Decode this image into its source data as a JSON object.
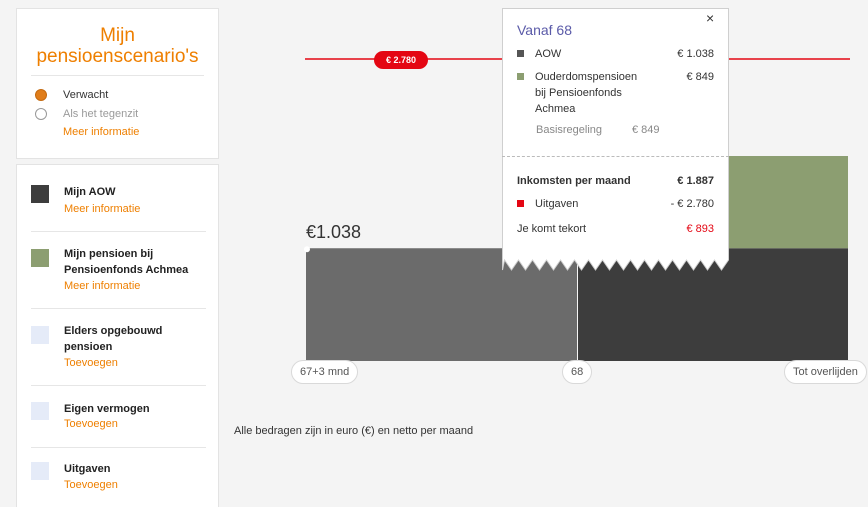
{
  "scenarios": {
    "title_line1": "Mijn",
    "title_line2": "pensioenscenario's",
    "options": [
      {
        "label": "Verwacht",
        "checked": true
      },
      {
        "label": "Als het tegenzit",
        "checked": false
      }
    ],
    "more_info": "Meer informatie"
  },
  "legend": {
    "items": [
      {
        "line1": "Mijn AOW",
        "line2": "",
        "link": "Meer informatie",
        "color": "#3d3d3d"
      },
      {
        "line1": "Mijn pensioen bij",
        "line2": "Pensioenfonds Achmea",
        "link": "Meer informatie",
        "color": "#8c9e71"
      },
      {
        "line1": "Elders opgebouwd",
        "line2": "pensioen",
        "link": "Toevoegen",
        "color": "#e5ebf8"
      },
      {
        "line1": "Eigen vermogen",
        "line2": "",
        "link": "Toevoegen",
        "color": "#e5ebf8"
      },
      {
        "line1": "Uitgaven",
        "line2": "",
        "link": "Toevoegen",
        "color": "#e5ebf8"
      }
    ]
  },
  "chart": {
    "expense_pill": "€ 2.780",
    "aow_value_label": "€1.038",
    "ticks": [
      "67+3 mnd",
      "68",
      "Tot overlijden"
    ],
    "footnote": "Alle bedragen zijn in euro (€) en netto per maand",
    "colors": {
      "aow_light": "#6b6b6b",
      "aow_dark": "#3d3d3d",
      "pension": "#8c9e71",
      "expense_line": "#e40613"
    }
  },
  "chart_data": {
    "type": "bar",
    "categories": [
      "67+3 mnd",
      "68"
    ],
    "series": [
      {
        "name": "AOW",
        "values": [
          1038,
          1038
        ]
      },
      {
        "name": "Ouderdomspensioen bij Pensioenfonds Achmea",
        "values": [
          0,
          849
        ]
      }
    ],
    "reference_line": {
      "name": "Uitgaven",
      "value": 2780
    }
  },
  "popup": {
    "title": "Vanaf 68",
    "close": "×",
    "rows": [
      {
        "name_line1": "AOW",
        "amount": "€ 1.038",
        "color": "#555555"
      },
      {
        "name_line1": "Ouderdomspensioen",
        "name_line2": "bij Pensioenfonds",
        "name_line3": "Achmea",
        "amount": "€ 849",
        "color": "#8c9e71"
      }
    ],
    "sub_label": "Basisregeling",
    "sub_amount": "€ 849",
    "income_label": "Inkomsten per maand",
    "income_amount": "€ 1.887",
    "expense_label": "Uitgaven",
    "expense_amount": "- € 2.780",
    "shortfall_label": "Je komt tekort",
    "shortfall_amount": "€ 893"
  }
}
